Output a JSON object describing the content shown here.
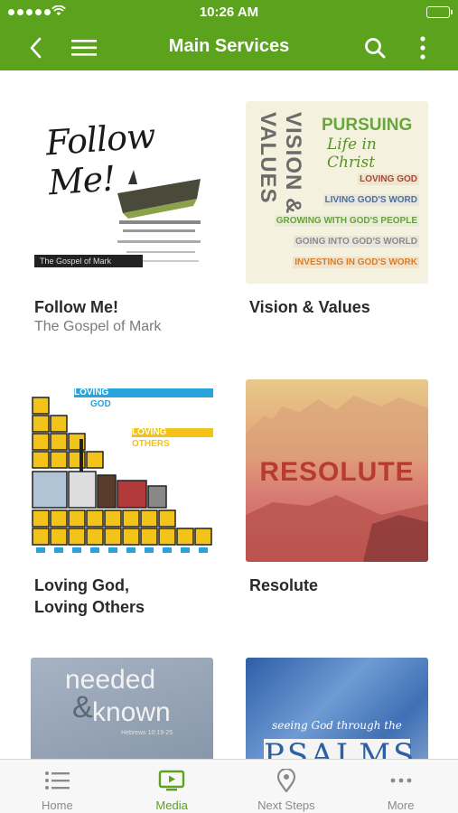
{
  "status": {
    "time": "10:26 AM"
  },
  "nav": {
    "title": "Main Services",
    "back_icon": "chevron-left-icon",
    "menu_icon": "hamburger-icon",
    "search_icon": "search-icon",
    "more_icon": "vertical-ellipsis-icon"
  },
  "colors": {
    "brand": "#5ba31d",
    "tab_inactive": "#8a8a8a"
  },
  "series": [
    {
      "title": "Follow Me!",
      "subtitle": "The Gospel of Mark",
      "art": {
        "script": "Follow Me!",
        "tag": "The Gospel of Mark"
      }
    },
    {
      "title": "Vision & Values",
      "subtitle": "",
      "art": {
        "vertical": "VISION & VALUES",
        "heading": "PURSUING",
        "subheading": "Life in Christ",
        "rows": [
          "LOVING GOD",
          "LIVING GOD'S WORD",
          "GROWING WITH GOD'S PEOPLE",
          "GOING INTO GOD'S WORLD",
          "INVESTING IN GOD'S WORK"
        ]
      }
    },
    {
      "title": "Loving God,",
      "title2": "Loving Others",
      "subtitle": "",
      "art": {
        "l1": "LOVING",
        "l2": "GOD",
        "l3": "LOVING",
        "l4": "OTHERS"
      }
    },
    {
      "title": "Resolute",
      "subtitle": "",
      "art": {
        "word": "RESOLUTE"
      }
    },
    {
      "title": "",
      "subtitle": "",
      "art": {
        "w1": "needed",
        "amp": "&",
        "w2": "known",
        "ref": "Hebrews 10:19-25"
      }
    },
    {
      "title": "",
      "subtitle": "",
      "art": {
        "see": "seeing God through the",
        "word": "PSALMS"
      }
    }
  ],
  "tabs": [
    {
      "label": "Home",
      "icon": "list-icon"
    },
    {
      "label": "Media",
      "icon": "tv-play-icon",
      "active": true
    },
    {
      "label": "Next Steps",
      "icon": "map-pin-icon"
    },
    {
      "label": "More",
      "icon": "horizontal-ellipsis-icon"
    }
  ]
}
